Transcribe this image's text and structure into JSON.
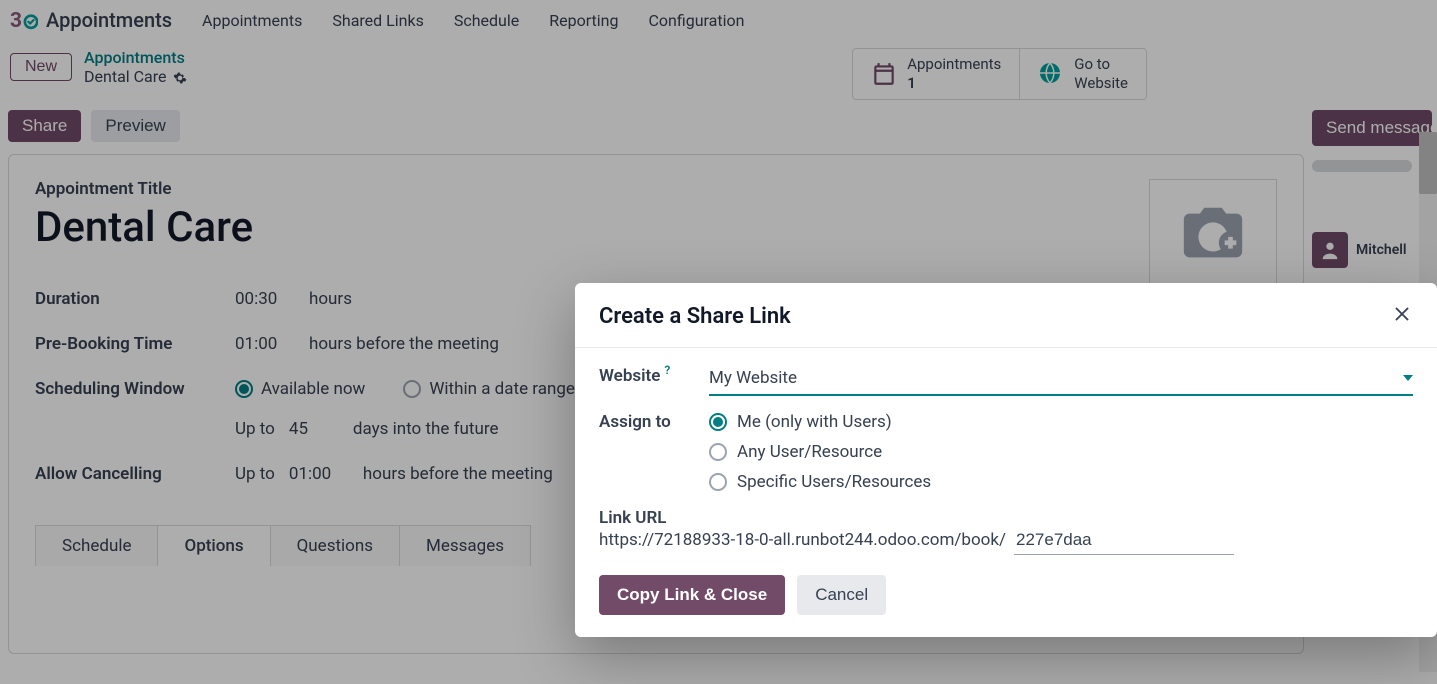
{
  "brand": {
    "title": "Appointments"
  },
  "nav": {
    "items": [
      "Appointments",
      "Shared Links",
      "Schedule",
      "Reporting",
      "Configuration"
    ]
  },
  "breadcrumb": {
    "new_button": "New",
    "parent": "Appointments",
    "current": "Dental Care"
  },
  "stat_buttons": {
    "appts": {
      "label": "Appointments",
      "count": "1"
    },
    "site": {
      "line1": "Go to",
      "line2": "Website"
    }
  },
  "actions": {
    "share": "Share",
    "preview": "Preview"
  },
  "form": {
    "title_label": "Appointment Title",
    "title_value": "Dental Care",
    "duration": {
      "label": "Duration",
      "value": "00:30",
      "unit": "hours"
    },
    "prebook": {
      "label": "Pre-Booking Time",
      "value": "01:00",
      "unit": "hours before the meeting"
    },
    "sched": {
      "label": "Scheduling Window",
      "opt_now": "Available now",
      "opt_range": "Within a date range",
      "upto": "Up to",
      "days_value": "45",
      "days_unit": "days into the future"
    },
    "cancel": {
      "label": "Allow Cancelling",
      "upto": "Up to",
      "value": "01:00",
      "unit": "hours before the meeting"
    }
  },
  "tabs": [
    "Schedule",
    "Options",
    "Questions",
    "Messages"
  ],
  "side": {
    "send": "Send message",
    "user": "Mitchell"
  },
  "modal": {
    "title": "Create a Share Link",
    "website_label": "Website",
    "website_value": "My Website",
    "assign_label": "Assign to",
    "assign_opts": [
      "Me (only with Users)",
      "Any User/Resource",
      "Specific Users/Resources"
    ],
    "linkurl_label": "Link URL",
    "linkurl_base": "https://72188933-18-0-all.runbot244.odoo.com/book/",
    "linkurl_slug": "227e7daa",
    "copy": "Copy Link & Close",
    "cancel": "Cancel"
  }
}
